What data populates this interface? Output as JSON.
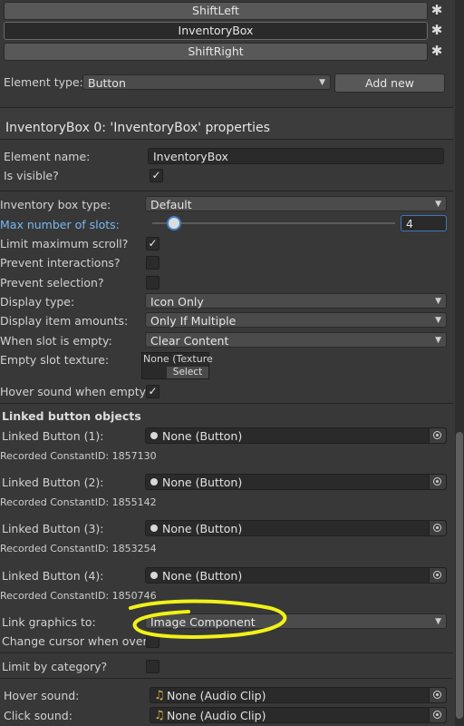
{
  "elements_list": [
    "ShiftLeft",
    "InventoryBox",
    "ShiftRight"
  ],
  "element_type": {
    "label": "Element type:",
    "value": "Button",
    "add_button": "Add new"
  },
  "properties_header": "InventoryBox 0: 'InventoryBox' properties",
  "element_name": {
    "label": "Element name:",
    "value": "InventoryBox"
  },
  "is_visible": {
    "label": "Is visible?",
    "checked": true
  },
  "inventory": {
    "box_type_label": "Inventory box type:",
    "box_type_value": "Default",
    "max_slots_label": "Max number of slots:",
    "max_slots_value": "4",
    "limit_scroll_label": "Limit maximum scroll?",
    "prevent_interactions_label": "Prevent interactions?",
    "prevent_selection_label": "Prevent selection?",
    "display_type_label": "Display type:",
    "display_type_value": "Icon Only",
    "display_amounts_label": "Display item amounts:",
    "display_amounts_value": "Only If Multiple",
    "when_empty_label": "When slot is empty:",
    "when_empty_value": "Clear Content",
    "empty_texture_label": "Empty slot texture:",
    "empty_texture_value": "None (Texture",
    "empty_texture_select": "Select",
    "hover_empty_label": "Hover sound when empty?"
  },
  "linked": {
    "title": "Linked button objects",
    "items": [
      {
        "label": "Linked Button (1):",
        "value": "None (Button)",
        "recorded": "Recorded ConstantID: 1857130"
      },
      {
        "label": "Linked Button (2):",
        "value": "None (Button)",
        "recorded": "Recorded ConstantID: 1855142"
      },
      {
        "label": "Linked Button (3):",
        "value": "None (Button)",
        "recorded": "Recorded ConstantID: 1853254"
      },
      {
        "label": "Linked Button (4):",
        "value": "None (Button)",
        "recorded": "Recorded ConstantID: 1850746"
      }
    ],
    "link_graphics_label": "Link graphics to:",
    "link_graphics_value": "Image Component",
    "change_cursor_label": "Change cursor when over?"
  },
  "limit_category_label": "Limit by category?",
  "sounds": {
    "hover_label": "Hover sound:",
    "hover_value": "None (Audio Clip)",
    "click_label": "Click sound:",
    "click_value": "None (Audio Clip)"
  },
  "colors": {
    "background": "#383838",
    "accent_blue": "#79b8f2",
    "annotation": "#f1f11a",
    "note_icon": "#e0b347"
  },
  "icons": {
    "gear": "gear-icon",
    "checkmark": "checkmark-icon",
    "dropdown": "dropdown-arrow-icon",
    "picker": "object-picker-icon",
    "audio": "music-note-icon"
  }
}
